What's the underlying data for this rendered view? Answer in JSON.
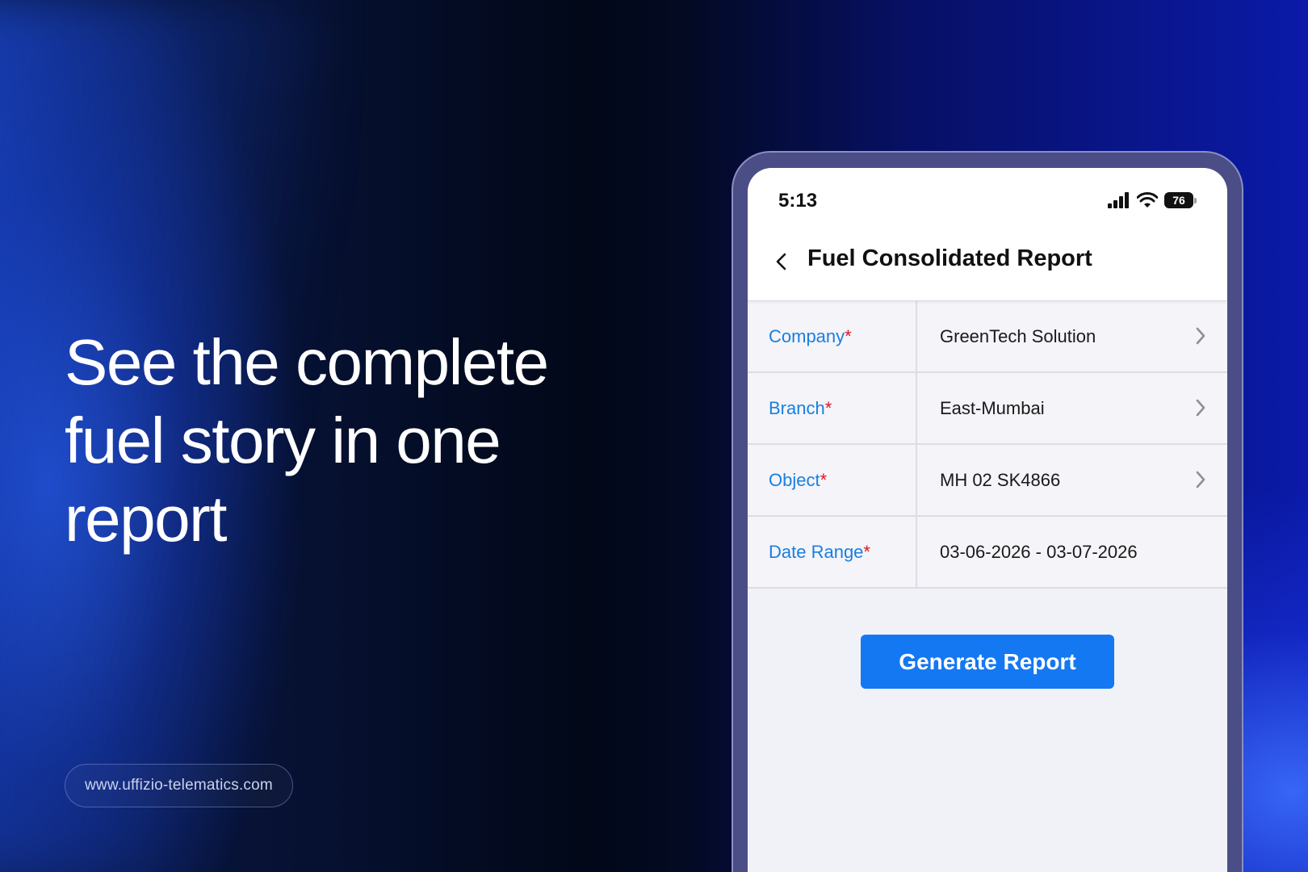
{
  "hero": {
    "headline": "See the complete fuel story in one report",
    "url": "www.uffizio-telematics.com"
  },
  "phone": {
    "status_time": "5:13",
    "battery_level": "76",
    "status_icons": [
      "signal-icon",
      "wifi-icon",
      "battery-icon"
    ],
    "title": "Fuel Consolidated Report",
    "required_marker": "*",
    "fields": [
      {
        "label": "Company",
        "value": "GreenTech Solution",
        "has_chevron": true
      },
      {
        "label": "Branch",
        "value": "East-Mumbai",
        "has_chevron": true
      },
      {
        "label": "Object",
        "value": "MH 02 SK4866",
        "has_chevron": true
      },
      {
        "label": "Date Range",
        "value": "03-06-2026 - 03-07-2026",
        "has_chevron": false
      }
    ],
    "generate_button": "Generate Report"
  },
  "colors": {
    "accent": "#1478f2",
    "label_blue": "#1a7fe0",
    "required_red": "#e0141e"
  }
}
